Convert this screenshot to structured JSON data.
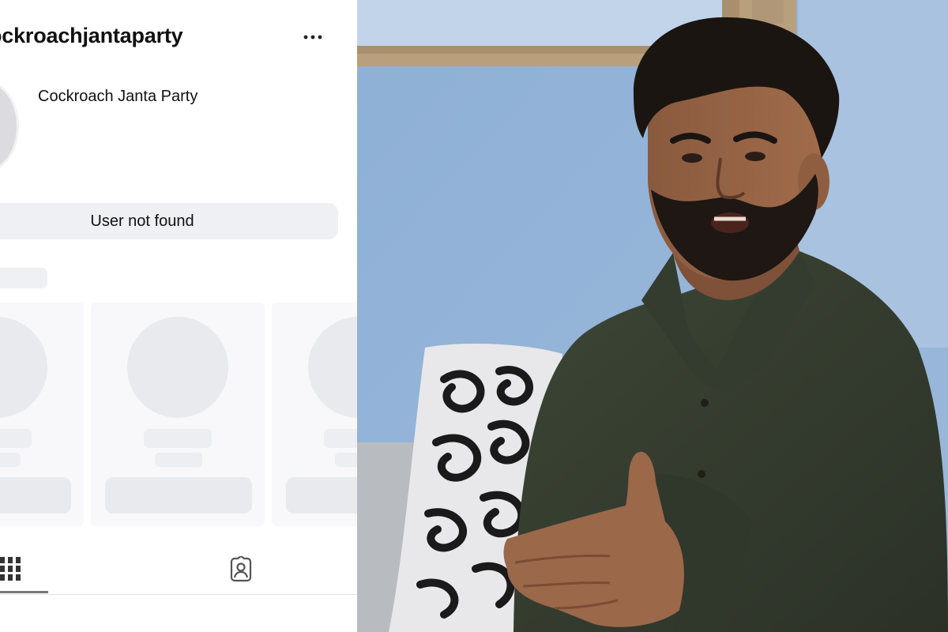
{
  "profile": {
    "username": "ockroachjantaparty",
    "display_name": "Cockroach Janta Party",
    "status_button": "User not found",
    "more_icon": "more-horizontal-icon",
    "tabs": [
      {
        "name": "posts-grid",
        "icon": "grid-icon",
        "selected": true
      },
      {
        "name": "tagged",
        "icon": "tagged-person-icon",
        "selected": false
      }
    ]
  },
  "photo": {
    "subject": "man-speaking-photo"
  }
}
